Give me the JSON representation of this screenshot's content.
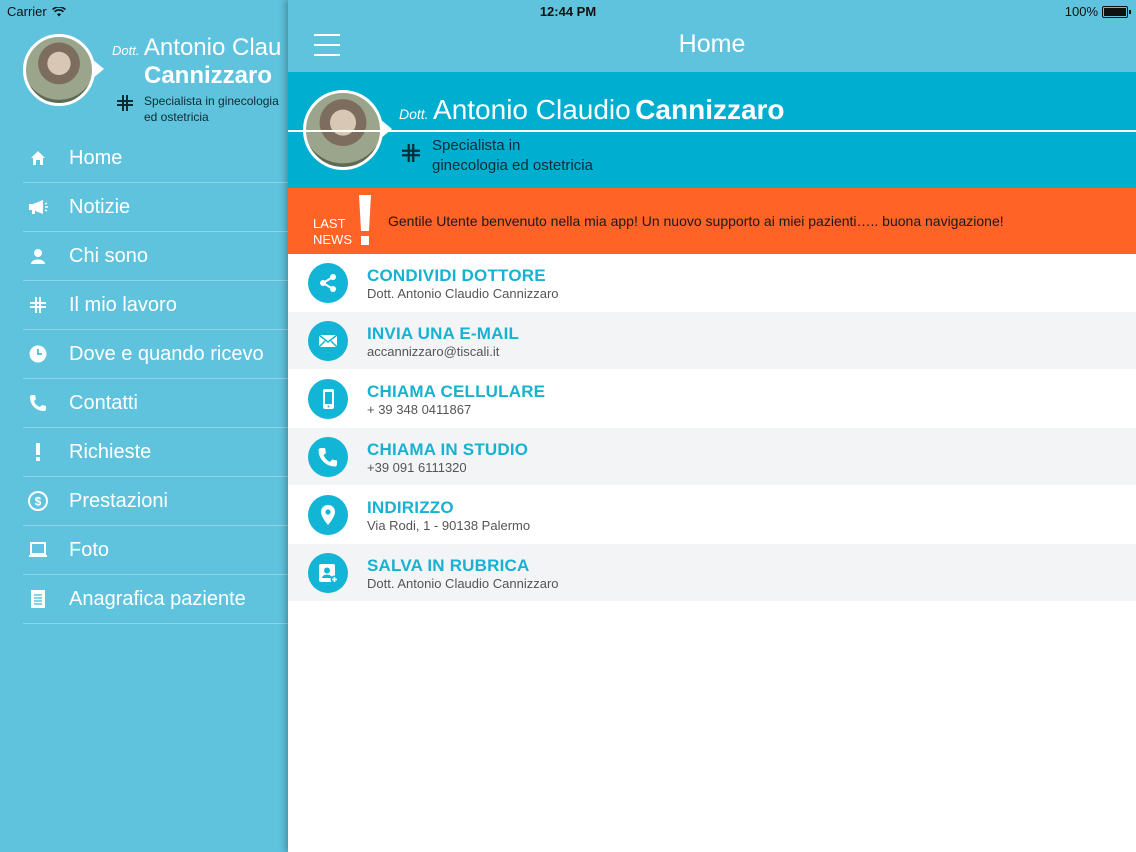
{
  "status_bar": {
    "carrier": "Carrier",
    "time": "12:44 PM",
    "battery": "100%"
  },
  "doctor": {
    "title": "Dott.",
    "first_name": "Antonio Claudio",
    "last_name": "Cannizzaro",
    "specialty_line1": "Specialista in",
    "specialty_line2": "ginecologia ed ostetricia"
  },
  "sidebar": {
    "first_name_clipped": "Antonio Clau",
    "specialty_line1": "Specialista in ginecologia",
    "specialty_line2": "ed ostetricia",
    "items": [
      {
        "label": "Home",
        "icon": "home-icon"
      },
      {
        "label": "Notizie",
        "icon": "megaphone-icon"
      },
      {
        "label": "Chi sono",
        "icon": "person-icon"
      },
      {
        "label": "Il mio lavoro",
        "icon": "cross-icon"
      },
      {
        "label": "Dove e quando ricevo",
        "icon": "clock-icon"
      },
      {
        "label": "Contatti",
        "icon": "phone-icon"
      },
      {
        "label": "Richieste",
        "icon": "exclamation-icon"
      },
      {
        "label": "Prestazioni",
        "icon": "dollar-icon"
      },
      {
        "label": "Foto",
        "icon": "monitor-icon"
      },
      {
        "label": "Anagrafica paziente",
        "icon": "document-icon"
      }
    ]
  },
  "navbar": {
    "title": "Home"
  },
  "news": {
    "label_line1": "LAST",
    "label_line2": "NEWS",
    "text": "Gentile Utente benvenuto nella mia app! Un nuovo supporto ai miei pazienti….. buona navigazione!"
  },
  "actions": [
    {
      "title": "CONDIVIDI DOTTORE",
      "subtitle": "Dott. Antonio Claudio Cannizzaro",
      "icon": "share-icon"
    },
    {
      "title": "INVIA UNA E-MAIL",
      "subtitle": "accannizzaro@tiscali.it",
      "icon": "envelope-icon"
    },
    {
      "title": "CHIAMA CELLULARE",
      "subtitle": "+ 39 348 0411867",
      "icon": "mobile-icon"
    },
    {
      "title": "CHIAMA IN STUDIO",
      "subtitle": "+39 091 6111320",
      "icon": "phone-icon"
    },
    {
      "title": "INDIRIZZO",
      "subtitle": "Via Rodi, 1 - 90138 Palermo",
      "icon": "location-pin-icon"
    },
    {
      "title": "SALVA IN RUBRICA",
      "subtitle": "Dott. Antonio Claudio Cannizzaro",
      "icon": "add-contact-icon"
    }
  ],
  "colors": {
    "accent": "#5fc3de",
    "header": "#00afd0",
    "news": "#ff6326",
    "action_title": "#17b1d2"
  }
}
